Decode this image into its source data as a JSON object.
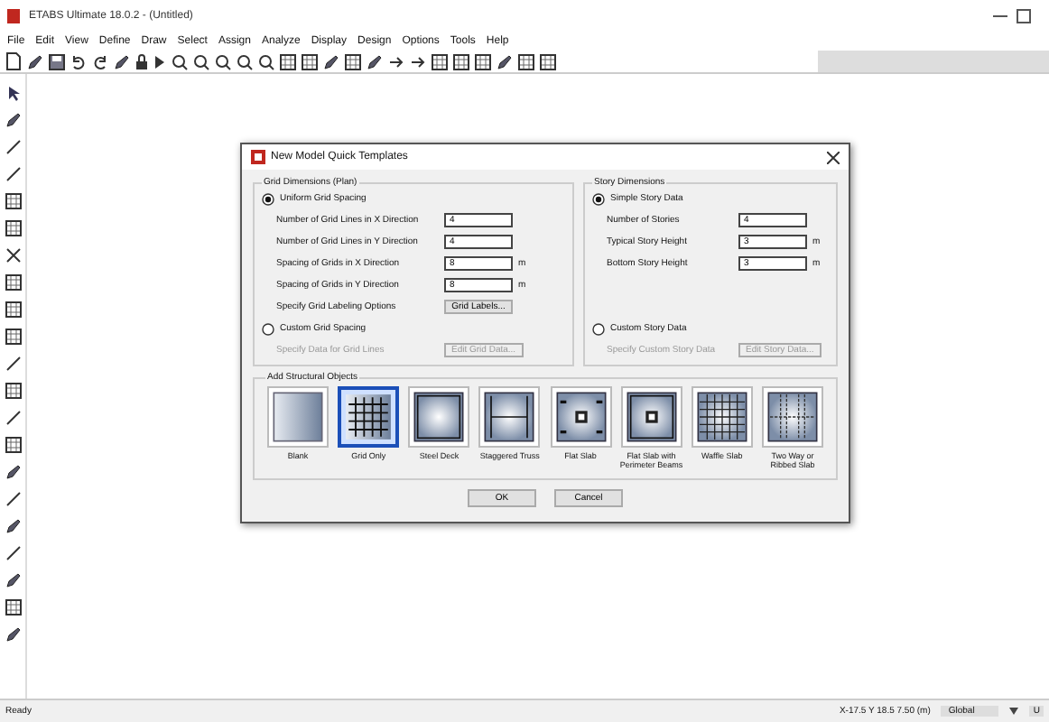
{
  "window": {
    "title": "ETABS Ultimate 18.0.2 - (Untitled)"
  },
  "menu": [
    "File",
    "Edit",
    "View",
    "Define",
    "Draw",
    "Select",
    "Assign",
    "Analyze",
    "Display",
    "Design",
    "Options",
    "Tools",
    "Help"
  ],
  "dialog": {
    "title": "New Model Quick Templates",
    "grid_group": {
      "title": "Grid Dimensions (Plan)",
      "uniform": {
        "label": "Uniform Grid Spacing",
        "selected": true
      },
      "fields": [
        {
          "label": "Number of Grid Lines in X Direction",
          "value": "4"
        },
        {
          "label": "Number of Grid Lines in Y Direction",
          "value": "4"
        },
        {
          "label": "Spacing of Grids in X Direction",
          "value": "8",
          "unit": "m"
        },
        {
          "label": "Spacing of Grids in Y Direction",
          "value": "8",
          "unit": "m"
        }
      ],
      "labeling": {
        "label": "Specify Grid Labeling Options",
        "button": "Grid Labels..."
      },
      "custom": {
        "label": "Custom Grid Spacing",
        "selected": false
      },
      "custom_row": {
        "label": "Specify Data for Grid Lines",
        "button": "Edit Grid Data...",
        "disabled": true
      }
    },
    "story_group": {
      "title": "Story Dimensions",
      "simple": {
        "label": "Simple Story Data",
        "selected": true
      },
      "fields": [
        {
          "label": "Number of Stories",
          "value": "4"
        },
        {
          "label": "Typical Story Height",
          "value": "3",
          "unit": "m"
        },
        {
          "label": "Bottom Story Height",
          "value": "3",
          "unit": "m"
        }
      ],
      "custom": {
        "label": "Custom Story Data",
        "selected": false
      },
      "custom_row": {
        "label": "Specify Custom Story Data",
        "button": "Edit Story Data...",
        "disabled": true
      }
    },
    "objects": {
      "title": "Add Structural Objects",
      "items": [
        {
          "label": "Blank",
          "kind": "blank",
          "selected": false
        },
        {
          "label": "Grid Only",
          "kind": "grid",
          "selected": true
        },
        {
          "label": "Steel Deck",
          "kind": "deck",
          "selected": false
        },
        {
          "label": "Staggered Truss",
          "kind": "truss",
          "selected": false
        },
        {
          "label": "Flat Slab",
          "kind": "flat",
          "selected": false
        },
        {
          "label": "Flat Slab with Perimeter Beams",
          "kind": "perimeter",
          "selected": false
        },
        {
          "label": "Waffle Slab",
          "kind": "waffle",
          "selected": false
        },
        {
          "label": "Two Way or Ribbed Slab",
          "kind": "ribbed",
          "selected": false
        }
      ]
    },
    "buttons": [
      "OK",
      "Cancel"
    ]
  },
  "status_bar": {
    "text": "Ready",
    "coords": "X-17.5 Y 18.5 7.50 (m)",
    "system": "Global",
    "units": "U"
  }
}
